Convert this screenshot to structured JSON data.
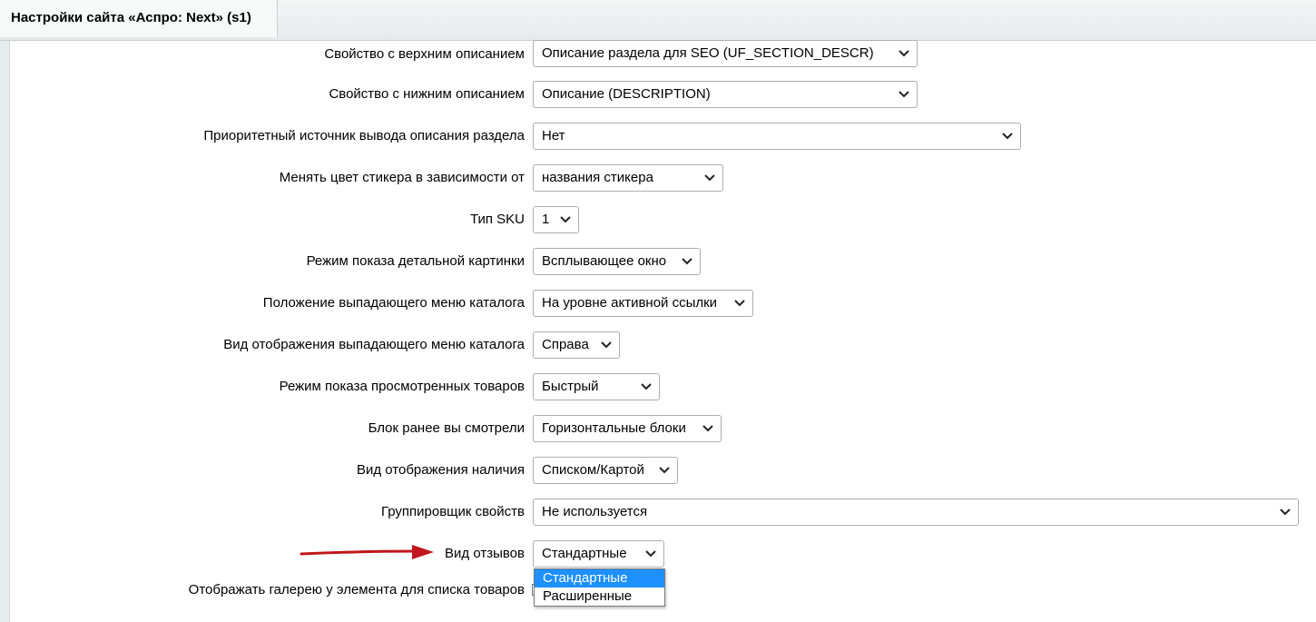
{
  "tab": {
    "title": "Настройки сайта «Аспро: Next» (s1)"
  },
  "rows": [
    {
      "label": "Свойство с верхним описанием",
      "value": "Описание раздела для SEO (UF_SECTION_DESCR)"
    },
    {
      "label": "Свойство с нижним описанием",
      "value": "Описание (DESCRIPTION)"
    },
    {
      "label": "Приоритетный источник вывода описания раздела",
      "value": "Нет"
    },
    {
      "label": "Менять цвет стикера в зависимости от",
      "value": "названия стикера"
    },
    {
      "label": "Тип SKU",
      "value": "1"
    },
    {
      "label": "Режим показа детальной картинки",
      "value": "Всплывающее окно"
    },
    {
      "label": "Положение выпадающего меню каталога",
      "value": "На уровне активной ссылки"
    },
    {
      "label": "Вид отображения выпадающего меню каталога",
      "value": "Справа"
    },
    {
      "label": "Режим показа просмотренных товаров",
      "value": "Быстрый"
    },
    {
      "label": "Блок ранее вы смотрели",
      "value": "Горизонтальные блоки"
    },
    {
      "label": "Вид отображения наличия",
      "value": "Списком/Картой"
    },
    {
      "label": "Группировщик свойств",
      "value": "Не используется"
    },
    {
      "label": "Вид отзывов",
      "value": "Стандартные"
    },
    {
      "label": "Отображать галерею у элемента для списка товаров"
    }
  ],
  "reviews_dropdown": {
    "options": [
      "Стандартные",
      "Расширенные"
    ],
    "selected": "Стандартные"
  },
  "colors": {
    "arrow": "#c0161c",
    "highlight": "#1e90ff"
  },
  "icons": {
    "select_caret": "chevron-down-icon",
    "annotation": "red-arrow-icon"
  }
}
